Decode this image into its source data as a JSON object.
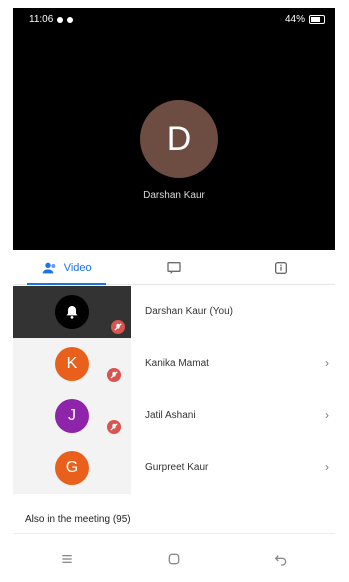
{
  "status_bar": {
    "time": "11:06",
    "battery": "44%"
  },
  "speaker": {
    "initial": "D",
    "name": "Darshan Kaur",
    "avatar_color": "#6d4c41"
  },
  "tabs": [
    {
      "label": "Video",
      "icon": "people-icon",
      "active": true
    },
    {
      "label": "",
      "icon": "chat-icon",
      "active": false
    },
    {
      "label": "",
      "icon": "info-icon",
      "active": false
    }
  ],
  "participants": [
    {
      "name": "Darshan Kaur (You)",
      "initial": "",
      "avatar_color": "#000000",
      "muted": true,
      "has_more": false
    },
    {
      "name": "Kanika Mamat",
      "initial": "K",
      "avatar_color": "#e8601c",
      "muted": true,
      "has_more": true
    },
    {
      "name": "Jatil Ashani",
      "initial": "J",
      "avatar_color": "#8e24aa",
      "muted": true,
      "has_more": true
    },
    {
      "name": "Gurpreet Kaur",
      "initial": "G",
      "avatar_color": "#e8601c",
      "muted": false,
      "has_more": true
    }
  ],
  "more_glyph": "›",
  "also_in_meeting": "Also in the meeting (95)",
  "colors": {
    "accent": "#1a73e8",
    "mute": "#d9534f"
  }
}
